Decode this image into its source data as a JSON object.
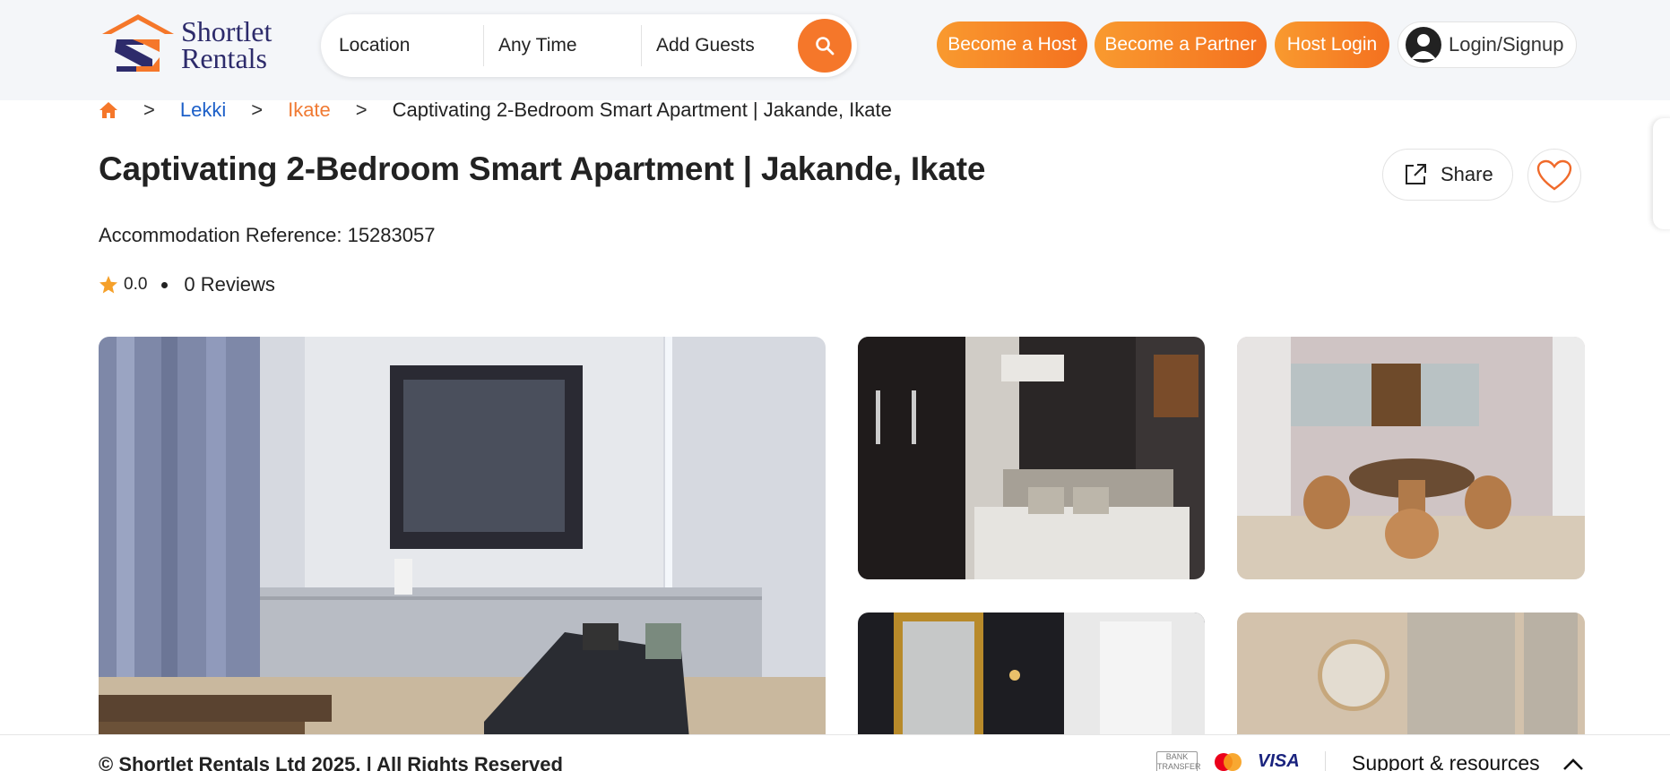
{
  "header": {
    "logo": {
      "line1": "Shortlet",
      "line2": "Rentals"
    },
    "search": {
      "location_label": "Location",
      "time_label": "Any Time",
      "guests_label": "Add Guests"
    },
    "buttons": {
      "become_host": "Become a Host",
      "become_partner": "Become a Partner",
      "host_login": "Host Login",
      "login_signup": "Login/Signup"
    }
  },
  "breadcrumb": {
    "separator": ">",
    "items": [
      "Lekki",
      "Ikate"
    ],
    "current": "Captivating 2-Bedroom Smart Apartment | Jakande, Ikate"
  },
  "listing": {
    "title": "Captivating 2-Bedroom Smart Apartment | Jakande, Ikate",
    "share_label": "Share",
    "reference_text": "Accommodation Reference: 15283057",
    "rating": "0.0",
    "reviews_text": "0 Reviews"
  },
  "footer": {
    "copyright": "© Shortlet Rentals Ltd 2025. | All Rights Reserved",
    "bank_transfer_label": "BANK TRANSFER",
    "visa_label": "VISA",
    "support_label": "Support & resources"
  },
  "colors": {
    "brand_orange": "#f5772a",
    "brand_navy": "#2d2b6b",
    "link_blue": "#1c5fc8"
  }
}
